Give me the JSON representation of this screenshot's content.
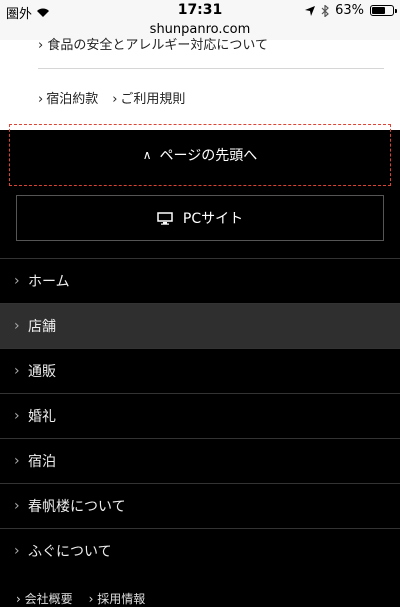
{
  "status_bar": {
    "carrier": "圏外",
    "time": "17:31",
    "battery_percent": "63%",
    "battery_level": 0.63
  },
  "browser": {
    "url": "shunpanro.com"
  },
  "content": {
    "partial_link": "食品の安全とアレルギー対応について",
    "links": [
      "宿泊約款",
      "ご利用規則"
    ]
  },
  "back_to_top": {
    "label": "ページの先頭へ"
  },
  "pc_site": {
    "label": "PCサイト"
  },
  "menu": {
    "items": [
      {
        "label": "ホーム"
      },
      {
        "label": "店舗"
      },
      {
        "label": "通販"
      },
      {
        "label": "婚礼"
      },
      {
        "label": "宿泊"
      },
      {
        "label": "春帆楼について"
      },
      {
        "label": "ふぐについて"
      }
    ],
    "active_index": 1
  },
  "footer_links": [
    "会社概要",
    "採用情報"
  ]
}
